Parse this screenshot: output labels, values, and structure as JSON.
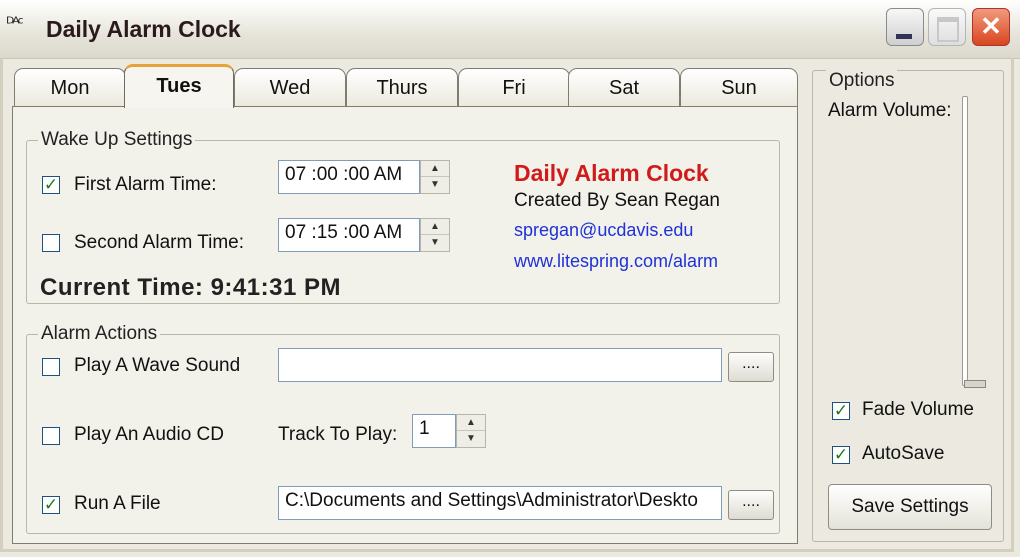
{
  "window": {
    "icon_glyph": "ᴰᴬᶜ",
    "title": "Daily Alarm Clock",
    "minimize_glyph": "",
    "maximize_glyph": "",
    "close_glyph": "✕"
  },
  "tabs": [
    {
      "label": "Mon"
    },
    {
      "label": "Tues"
    },
    {
      "label": "Wed"
    },
    {
      "label": "Thurs"
    },
    {
      "label": "Fri"
    },
    {
      "label": "Sat"
    },
    {
      "label": "Sun"
    }
  ],
  "active_tab": "Tues",
  "wake_up": {
    "legend": "Wake Up Settings",
    "first_alarm": {
      "checked": true,
      "label": "First Alarm Time:",
      "value": "07 :00 :00 AM"
    },
    "second_alarm": {
      "checked": false,
      "label": "Second Alarm Time:",
      "value": "07 :15 :00 AM"
    },
    "current_time": "Current Time: 9:41:31 PM"
  },
  "about": {
    "title": "Daily Alarm Clock",
    "author": "Created By Sean Regan",
    "email": "spregan@ucdavis.edu",
    "website": "www.litespring.com/alarm"
  },
  "alarm_actions": {
    "legend": "Alarm Actions",
    "wave": {
      "checked": false,
      "label": "Play A Wave Sound",
      "path": "",
      "browse": "...."
    },
    "cd": {
      "checked": false,
      "label": "Play An Audio CD",
      "track_label": "Track To Play:",
      "track_value": "1"
    },
    "run_file": {
      "checked": true,
      "label": "Run A File",
      "path": "C:\\Documents and Settings\\Administrator\\Deskto",
      "browse": "...."
    }
  },
  "options": {
    "legend": "Options",
    "volume_label": "Alarm Volume:",
    "volume_level": 0,
    "fade_volume": {
      "checked": true,
      "label": "Fade Volume"
    },
    "autosave": {
      "checked": true,
      "label": "AutoSave"
    },
    "save_button": "Save Settings"
  },
  "check_glyph": "✓",
  "spin": {
    "up": "▲",
    "down": "▼"
  }
}
